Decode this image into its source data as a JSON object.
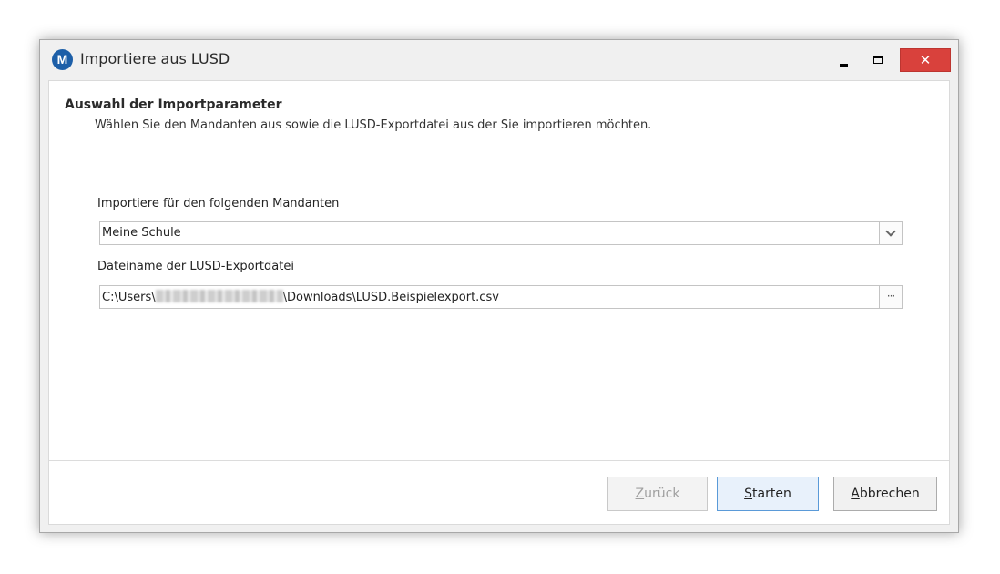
{
  "window": {
    "title": "Importiere aus LUSD",
    "icon_letter": "M",
    "controls": {
      "minimize": "minimize",
      "maximize": "maximize",
      "close": "✕"
    }
  },
  "header": {
    "title": "Auswahl der Importparameter",
    "subtitle": "Wählen Sie den Mandanten aus sowie die LUSD-Exportdatei aus der Sie importieren möchten."
  },
  "fields": {
    "mandant": {
      "label": "Importiere für den folgenden Mandanten",
      "value": "Meine Schule"
    },
    "exportfile": {
      "label": "Dateiname der LUSD-Exportdatei",
      "value_prefix": "C:\\Users\\",
      "value_suffix": "\\Downloads\\LUSD.Beispielexport.csv",
      "browse_label": "···"
    }
  },
  "buttons": {
    "back": {
      "mnemonic": "Z",
      "rest": "urück",
      "enabled": false
    },
    "start": {
      "mnemonic": "S",
      "rest": "tarten",
      "enabled": true
    },
    "cancel": {
      "mnemonic": "A",
      "rest": "bbrechen",
      "enabled": true
    }
  },
  "colors": {
    "close_button": "#d9413c",
    "app_icon": "#1d5fa8",
    "default_button_border": "#5a9ad8"
  }
}
